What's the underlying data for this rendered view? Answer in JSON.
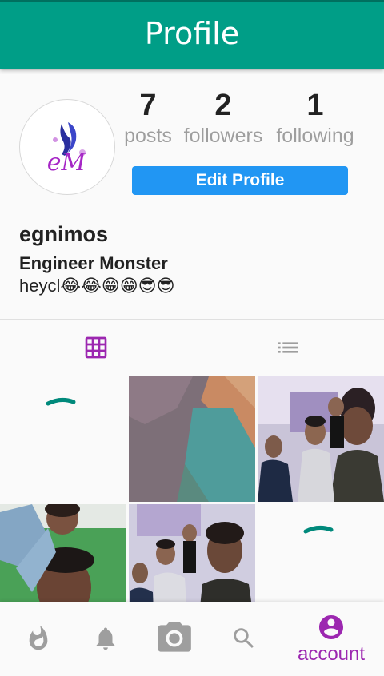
{
  "app_bar": {
    "title": "Profile"
  },
  "profile": {
    "stats": {
      "posts": {
        "count": "7",
        "label": "posts"
      },
      "followers": {
        "count": "2",
        "label": "followers"
      },
      "following": {
        "count": "1",
        "label": "following"
      }
    },
    "edit_button_label": "Edit Profile",
    "username": "egnimos",
    "display_name": "Engineer Monster",
    "bio": "heycl😂😂😁😁😎😎",
    "avatar_logo_text": "eM"
  },
  "tabs": [
    {
      "icon": "grid-icon",
      "selected": true
    },
    {
      "icon": "list-icon",
      "selected": false
    }
  ],
  "posts": [
    {
      "type": "loading"
    },
    {
      "type": "photo",
      "subject": "closeup fabric"
    },
    {
      "type": "photo",
      "subject": "group selfie"
    },
    {
      "type": "photo",
      "subject": "selfie outdoor"
    },
    {
      "type": "photo",
      "subject": "group selfie"
    },
    {
      "type": "loading"
    }
  ],
  "bottom_nav": {
    "items": [
      {
        "icon": "flame-icon",
        "label": ""
      },
      {
        "icon": "bell-icon",
        "label": ""
      },
      {
        "icon": "camera-icon",
        "label": ""
      },
      {
        "icon": "search-icon",
        "label": ""
      },
      {
        "icon": "account-circle-icon",
        "label": "account",
        "active": true
      }
    ]
  },
  "colors": {
    "appbar": "#009e87",
    "accent": "#9c27b0",
    "button": "#2196f3",
    "spinner": "#00897b",
    "nav_inactive": "#9e9e9e"
  }
}
